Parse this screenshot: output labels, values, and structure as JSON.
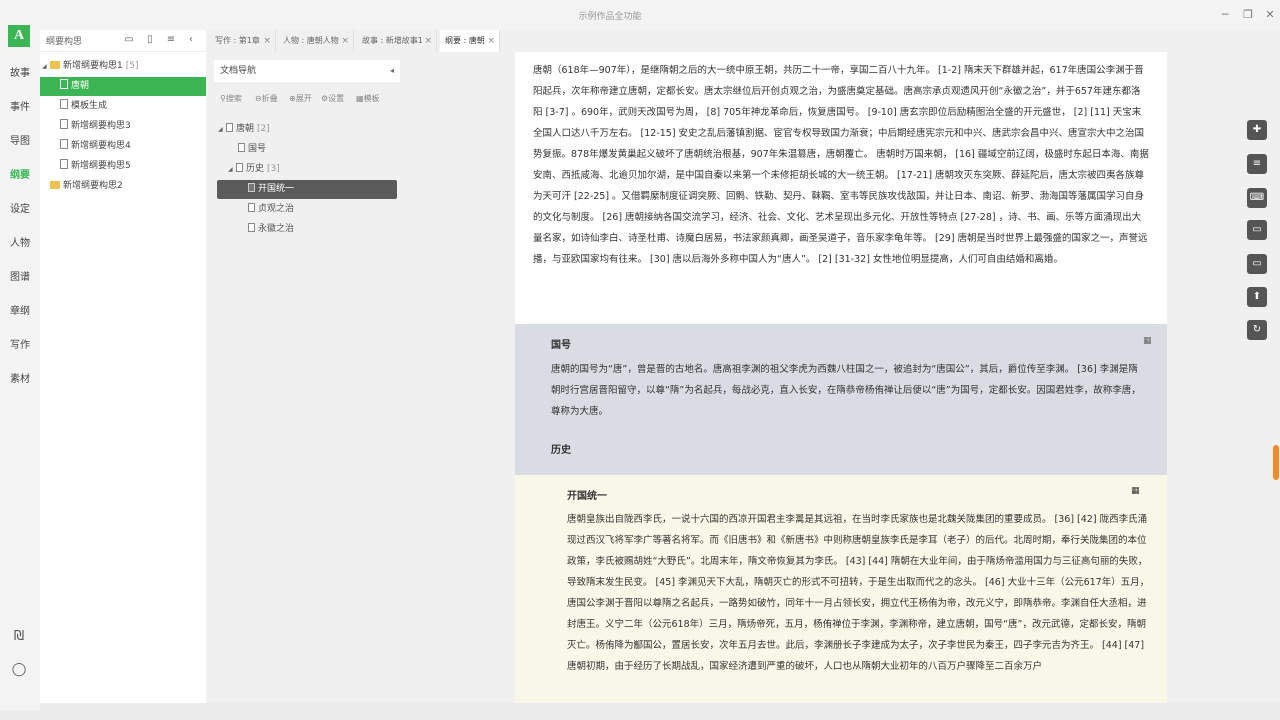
{
  "app": {
    "title": "示例作品全功能",
    "logo": "A"
  },
  "nav": {
    "items": [
      "故事",
      "事件",
      "导图",
      "纲要",
      "设定",
      "人物",
      "图谱",
      "章纲",
      "写作",
      "素材"
    ],
    "active_index": 3,
    "accent": "#3cb655"
  },
  "outline": {
    "title": "纲要构思",
    "tree": [
      {
        "label": "新增纲要构思1",
        "count": "[5]",
        "type": "folder"
      },
      {
        "label": "唐朝",
        "count": "",
        "type": "doc"
      },
      {
        "label": "模板生成",
        "count": "",
        "type": "doc"
      },
      {
        "label": "新增纲要构思3",
        "count": "",
        "type": "doc"
      },
      {
        "label": "新增纲要构思4",
        "count": "",
        "type": "doc"
      },
      {
        "label": "新增纲要构思5",
        "count": "",
        "type": "doc"
      },
      {
        "label": "新增纲要构思2",
        "count": "",
        "type": "folder"
      }
    ]
  },
  "tabs": [
    {
      "label": "写作 : 第1章"
    },
    {
      "label": "人物 : 唐朝人物"
    },
    {
      "label": "故事 : 新增故事1"
    },
    {
      "label": "纲要 : 唐朝"
    }
  ],
  "docnav": {
    "header": "文档导航",
    "tools": [
      "搜索",
      "折叠",
      "展开",
      "设置",
      "模板"
    ],
    "tree": [
      {
        "label": "唐朝",
        "count": "[2]"
      },
      {
        "label": "国号",
        "count": ""
      },
      {
        "label": "历史",
        "count": "[3]"
      },
      {
        "label": "开国统一",
        "count": ""
      },
      {
        "label": "贞观之治",
        "count": ""
      },
      {
        "label": "永徽之治",
        "count": ""
      }
    ]
  },
  "editor": {
    "root_text": "唐朝（618年—907年），是继隋朝之后的大一统中原王朝，共历二十一帝，享国二百八十九年。 [1-2] 隋末天下群雄并起，617年唐国公李渊于晋阳起兵，次年称帝建立唐朝，定都长安。唐太宗继位后开创贞观之治，为盛唐奠定基础。唐高宗承贞观遗风开创“永徽之治”，并于657年建东都洛阳 [3-7] 。690年，武则天改国号为周， [8] 705年神龙革命后，恢复唐国号。 [9-10] 唐玄宗即位后励精图治全盛的开元盛世， [2] [11] 天宝末全国人口达八千万左右。 [12-15] 安史之乱后藩镇割据、宦官专权导致国力渐衰；中后期经唐宪宗元和中兴、唐武宗会昌中兴、唐宣宗大中之治国势复振。878年爆发黄巢起义破坏了唐朝统治根基，907年朱温篡唐，唐朝覆亡。 唐朝时万国来朝， [16] 疆域空前辽阔，极盛时东起日本海、南据安南、西抵咸海、北逾贝加尔湖，是中国自秦以来第一个未修拒胡长城的大一统王朝。 [17-21] 唐朝攻灭东突厥、薛延陀后，唐太宗被四夷各族尊为天可汗 [22-25] 。又借羁縻制度征调突厥、回鹘、铁勒、契丹、靺鞨、室韦等民族攻伐敌国，并让日本、南诏、新罗、渤海国等藩属国学习自身的文化与制度。 [26] 唐朝接纳各国交流学习，经济、社会、文化、艺术呈现出多元化、开放性等特点 [27-28] ，诗、书、画、乐等方面涌现出大量名家，如诗仙李白、诗圣杜甫、诗魔白居易，书法家颜真卿，画圣吴道子，音乐家李龟年等。 [29] 唐朝是当时世界上最强盛的国家之一，声誉远播，与亚欧国家均有往来。 [30] 唐以后海外多称中国人为“唐人”。 [2] [31-32] 女性地位明显提高，人们可自由结婚和离婚。",
    "guohao_title": "国号",
    "guohao_text": "唐朝的国号为“唐”，曾是晋的古地名。唐高祖李渊的祖父李虎为西魏八柱国之一，被追封为“唐国公”，其后，爵位传至李渊。 [36] 李渊是隋朝时行宫居晋阳留守，以尊“隋”为名起兵，每战必克，直入长安，在隋恭帝杨侑禅让后便以“唐”为国号，定都长安。因国君姓李，故称李唐，尊称为大唐。",
    "lishi_title": "历史",
    "kaiguo_title": "开国统一",
    "kaiguo_text": "唐朝皇族出自陇西李氏，一说十六国的西凉开国君主李暠是其远祖，在当时李氏家族也是北魏关陇集团的重要成员。 [36] [42] 陇西李氏涌现过西汉飞将军李广等著名将军。而《旧唐书》和《新唐书》中则称唐朝皇族李氏是李耳（老子）的后代。北周时期，奉行关陇集团的本位政策，李氏被赐胡姓“大野氏”。北周末年，隋文帝恢复其为李氏。 [43] [44] 隋朝在大业年间，由于隋炀帝滥用国力与三征高句丽的失败，导致隋末发生民变。 [45] 李渊见天下大乱，隋朝灭亡的形式不可扭转，于是生出取而代之的念头。 [46] 大业十三年（公元617年）五月，唐国公李渊于晋阳以尊隋之名起兵，一路势如破竹，同年十一月占领长安，拥立代王杨侑为帝，改元义宁，即隋恭帝。李渊自任大丞相，进封唐王。义宁二年（公元618年）三月，隋炀帝死，五月，杨侑禅位于李渊，李渊称帝，建立唐朝，国号“唐”，改元武德，定都长安，隋朝灭亡。杨侑降为酅国公，置居长安，次年五月去世。此后，李渊册长子李建成为太子，次子李世民为秦王，四子李元吉为齐王。 [44] [47] 唐朝初期，由于经历了长期战乱，国家经济遭到严重的破坏，人口也从隋朝大业初年的八百万户骤降至二百余万户"
  }
}
